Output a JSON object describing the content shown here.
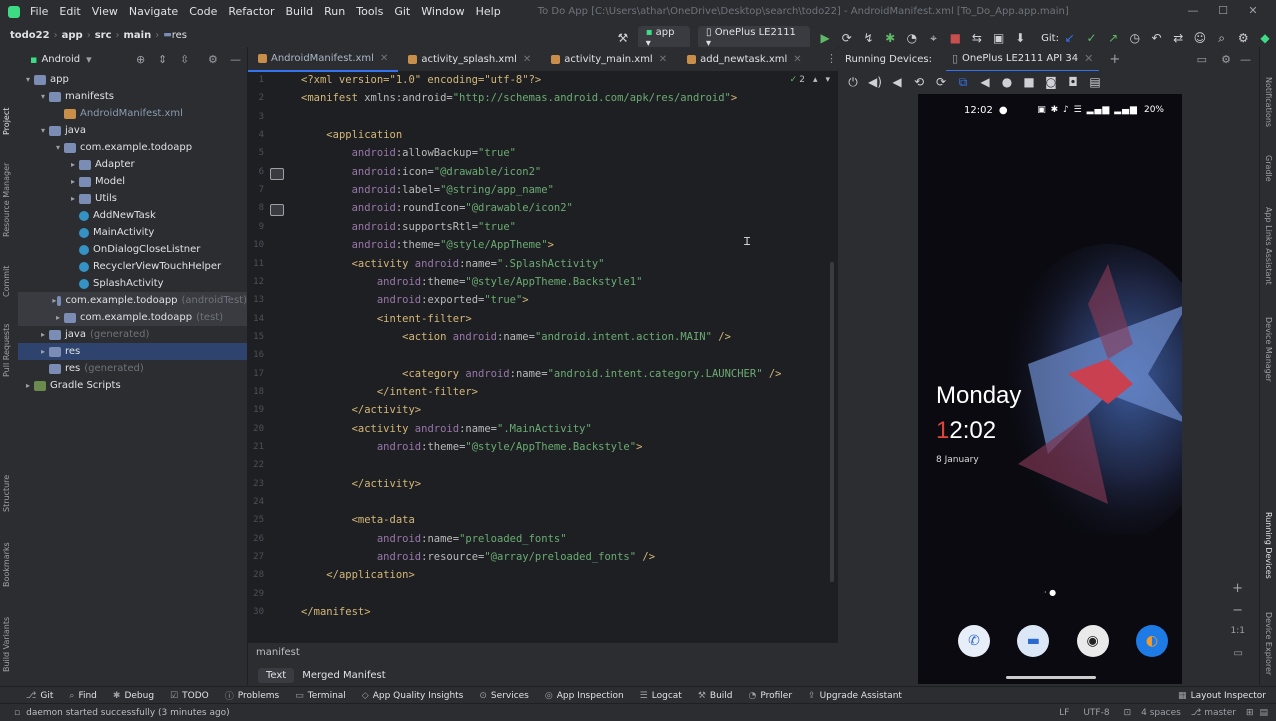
{
  "menu": [
    "File",
    "Edit",
    "View",
    "Navigate",
    "Code",
    "Refactor",
    "Build",
    "Run",
    "Tools",
    "Git",
    "Window",
    "Help"
  ],
  "window_title": "To Do App [C:\\Users\\athar\\OneDrive\\Desktop\\search\\todo22] - AndroidManifest.xml [To_Do_App.app.main]",
  "breadcrumb": [
    "todo22",
    "app",
    "src",
    "main",
    "res"
  ],
  "toolbar": {
    "run_config": "app",
    "device": "OnePlus LE2111",
    "git_label": "Git:"
  },
  "project": {
    "view_label": "Android",
    "tree": [
      {
        "label": "app",
        "indent": 0,
        "arrow": "▾",
        "icon": "folder"
      },
      {
        "label": "manifests",
        "indent": 1,
        "arrow": "▾",
        "icon": "folder"
      },
      {
        "label": "AndroidManifest.xml",
        "indent": 2,
        "arrow": "",
        "icon": "xmlf",
        "muted": true
      },
      {
        "label": "java",
        "indent": 1,
        "arrow": "▾",
        "icon": "folder"
      },
      {
        "label": "com.example.todoapp",
        "indent": 2,
        "arrow": "▾",
        "icon": "folder"
      },
      {
        "label": "Adapter",
        "indent": 3,
        "arrow": "▸",
        "icon": "folder"
      },
      {
        "label": "Model",
        "indent": 3,
        "arrow": "▸",
        "icon": "folder"
      },
      {
        "label": "Utils",
        "indent": 3,
        "arrow": "▸",
        "icon": "folder"
      },
      {
        "label": "AddNewTask",
        "indent": 3,
        "arrow": "",
        "icon": "cls"
      },
      {
        "label": "MainActivity",
        "indent": 3,
        "arrow": "",
        "icon": "cls"
      },
      {
        "label": "OnDialogCloseListner",
        "indent": 3,
        "arrow": "",
        "icon": "cls"
      },
      {
        "label": "RecyclerViewTouchHelper",
        "indent": 3,
        "arrow": "",
        "icon": "cls"
      },
      {
        "label": "SplashActivity",
        "indent": 3,
        "arrow": "",
        "icon": "cls"
      },
      {
        "label": "com.example.todoapp",
        "indent": 2,
        "arrow": "▸",
        "icon": "folder",
        "suffix": "(androidTest)",
        "grey": true
      },
      {
        "label": "com.example.todoapp",
        "indent": 2,
        "arrow": "▸",
        "icon": "folder",
        "suffix": "(test)",
        "grey": true
      },
      {
        "label": "java",
        "indent": 1,
        "arrow": "▸",
        "icon": "folder",
        "suffix": "(generated)"
      },
      {
        "label": "res",
        "indent": 1,
        "arrow": "▸",
        "icon": "folder",
        "selected": true
      },
      {
        "label": "res",
        "indent": 1,
        "arrow": "",
        "icon": "folder",
        "suffix": "(generated)"
      },
      {
        "label": "Gradle Scripts",
        "indent": 0,
        "arrow": "▸",
        "icon": "gradle"
      }
    ]
  },
  "editor_tabs": [
    "AndroidManifest.xml",
    "activity_splash.xml",
    "activity_main.xml",
    "add_newtask.xml"
  ],
  "editor": {
    "problems_count": "2",
    "breadcrumb": "manifest",
    "bottom_tabs": [
      "Text",
      "Merged Manifest"
    ],
    "lines": [
      {
        "n": "1",
        "t": [
          [
            "decl",
            "<?xml version=\"1.0\" encoding=\"utf-8\"?>"
          ]
        ]
      },
      {
        "n": "2",
        "t": [
          [
            "tag",
            "<manifest "
          ],
          [
            "attr",
            "xmlns:android"
          ],
          [
            "pun",
            "="
          ],
          [
            "val",
            "\"http://schemas.android.com/apk/res/android\""
          ],
          [
            "tag",
            ">"
          ]
        ]
      },
      {
        "n": "3",
        "t": []
      },
      {
        "n": "4",
        "t": [
          [
            "pun",
            "    "
          ],
          [
            "tag",
            "<application"
          ]
        ]
      },
      {
        "n": "5",
        "t": [
          [
            "pun",
            "        "
          ],
          [
            "ns",
            "android"
          ],
          [
            "attr",
            ":allowBackup"
          ],
          [
            "pun",
            "="
          ],
          [
            "val",
            "\"true\""
          ]
        ]
      },
      {
        "n": "6",
        "t": [
          [
            "pun",
            "        "
          ],
          [
            "ns",
            "android"
          ],
          [
            "attr",
            ":icon"
          ],
          [
            "pun",
            "="
          ],
          [
            "val",
            "\"@drawable/icon2\""
          ]
        ]
      },
      {
        "n": "7",
        "t": [
          [
            "pun",
            "        "
          ],
          [
            "ns",
            "android"
          ],
          [
            "attr",
            ":label"
          ],
          [
            "pun",
            "="
          ],
          [
            "val",
            "\"@string/app_name\""
          ]
        ]
      },
      {
        "n": "8",
        "t": [
          [
            "pun",
            "        "
          ],
          [
            "ns",
            "android"
          ],
          [
            "attr",
            ":roundIcon"
          ],
          [
            "pun",
            "="
          ],
          [
            "val",
            "\"@drawable/icon2\""
          ]
        ]
      },
      {
        "n": "9",
        "t": [
          [
            "pun",
            "        "
          ],
          [
            "ns",
            "android"
          ],
          [
            "attr",
            ":supportsRtl"
          ],
          [
            "pun",
            "="
          ],
          [
            "val",
            "\"true\""
          ]
        ]
      },
      {
        "n": "10",
        "t": [
          [
            "pun",
            "        "
          ],
          [
            "ns",
            "android"
          ],
          [
            "attr",
            ":theme"
          ],
          [
            "pun",
            "="
          ],
          [
            "val",
            "\"@style/AppTheme\""
          ],
          [
            "tag",
            ">"
          ]
        ]
      },
      {
        "n": "11",
        "t": [
          [
            "pun",
            "        "
          ],
          [
            "tag",
            "<activity "
          ],
          [
            "ns",
            "android"
          ],
          [
            "attr",
            ":name"
          ],
          [
            "pun",
            "="
          ],
          [
            "val",
            "\".SplashActivity\""
          ]
        ]
      },
      {
        "n": "12",
        "t": [
          [
            "pun",
            "            "
          ],
          [
            "ns",
            "android"
          ],
          [
            "attr",
            ":theme"
          ],
          [
            "pun",
            "="
          ],
          [
            "val",
            "\"@style/AppTheme.Backstyle1\""
          ]
        ]
      },
      {
        "n": "13",
        "t": [
          [
            "pun",
            "            "
          ],
          [
            "ns",
            "android"
          ],
          [
            "attr",
            ":exported"
          ],
          [
            "pun",
            "="
          ],
          [
            "val",
            "\"true\""
          ],
          [
            "tag",
            ">"
          ]
        ]
      },
      {
        "n": "14",
        "t": [
          [
            "pun",
            "            "
          ],
          [
            "tag",
            "<intent-filter>"
          ]
        ]
      },
      {
        "n": "15",
        "t": [
          [
            "pun",
            "                "
          ],
          [
            "tag",
            "<action "
          ],
          [
            "ns",
            "android"
          ],
          [
            "attr",
            ":name"
          ],
          [
            "pun",
            "="
          ],
          [
            "val",
            "\"android.intent.action.MAIN\""
          ],
          [
            "tag",
            " />"
          ]
        ]
      },
      {
        "n": "16",
        "t": []
      },
      {
        "n": "17",
        "t": [
          [
            "pun",
            "                "
          ],
          [
            "tag",
            "<category "
          ],
          [
            "ns",
            "android"
          ],
          [
            "attr",
            ":name"
          ],
          [
            "pun",
            "="
          ],
          [
            "val",
            "\"android.intent.category.LAUNCHER\""
          ],
          [
            "tag",
            " />"
          ]
        ]
      },
      {
        "n": "18",
        "t": [
          [
            "pun",
            "            "
          ],
          [
            "tag",
            "</intent-filter>"
          ]
        ]
      },
      {
        "n": "19",
        "t": [
          [
            "pun",
            "        "
          ],
          [
            "tag",
            "</activity>"
          ]
        ]
      },
      {
        "n": "20",
        "t": [
          [
            "pun",
            "        "
          ],
          [
            "tag",
            "<activity "
          ],
          [
            "ns",
            "android"
          ],
          [
            "attr",
            ":name"
          ],
          [
            "pun",
            "="
          ],
          [
            "val",
            "\".MainActivity\""
          ]
        ]
      },
      {
        "n": "21",
        "t": [
          [
            "pun",
            "            "
          ],
          [
            "ns",
            "android"
          ],
          [
            "attr",
            ":theme"
          ],
          [
            "pun",
            "="
          ],
          [
            "val",
            "\"@style/AppTheme.Backstyle\""
          ],
          [
            "tag",
            ">"
          ]
        ]
      },
      {
        "n": "22",
        "t": []
      },
      {
        "n": "23",
        "t": [
          [
            "pun",
            "        "
          ],
          [
            "tag",
            "</activity>"
          ]
        ]
      },
      {
        "n": "24",
        "t": []
      },
      {
        "n": "25",
        "t": [
          [
            "pun",
            "        "
          ],
          [
            "tag",
            "<meta-data"
          ]
        ]
      },
      {
        "n": "26",
        "t": [
          [
            "pun",
            "            "
          ],
          [
            "ns",
            "android"
          ],
          [
            "attr",
            ":name"
          ],
          [
            "pun",
            "="
          ],
          [
            "val",
            "\"preloaded_fonts\""
          ]
        ]
      },
      {
        "n": "27",
        "t": [
          [
            "pun",
            "            "
          ],
          [
            "ns",
            "android"
          ],
          [
            "attr",
            ":resource"
          ],
          [
            "pun",
            "="
          ],
          [
            "val",
            "\"@array/preloaded_fonts\""
          ],
          [
            "tag",
            " />"
          ]
        ]
      },
      {
        "n": "28",
        "t": [
          [
            "pun",
            "    "
          ],
          [
            "tag",
            "</application>"
          ]
        ]
      },
      {
        "n": "29",
        "t": []
      },
      {
        "n": "30",
        "t": [
          [
            "tag",
            "</manifest>"
          ]
        ]
      }
    ]
  },
  "running_devices": {
    "label": "Running Devices:",
    "device_tab": "OnePlus LE2111 API 34",
    "phone": {
      "status_time": "12:02",
      "battery": "20%",
      "day": "Monday",
      "clock_first": "1",
      "clock_rest": "2:02",
      "date": "8 January"
    }
  },
  "left_stripe": [
    "Project",
    "Resource Manager",
    "Commit",
    "Pull Requests",
    "Structure",
    "Bookmarks",
    "Build Variants"
  ],
  "right_stripe": [
    "Notifications",
    "Gradle",
    "App Links Assistant",
    "Device Manager",
    "Running Devices",
    "Device Explorer"
  ],
  "bottom_tools": [
    "Git",
    "Find",
    "Debug",
    "TODO",
    "Problems",
    "Terminal",
    "App Quality Insights",
    "Services",
    "App Inspection",
    "Logcat",
    "Build",
    "Profiler",
    "Upgrade Assistant"
  ],
  "layout_inspector": "Layout Inspector",
  "status": {
    "message": "daemon started successfully (3 minutes ago)",
    "line_sep": "LF",
    "encoding": "UTF-8",
    "indent": "4 spaces",
    "branch": "master"
  },
  "colors": {
    "accent": "#3574f0",
    "selection": "#2e436e",
    "run_green": "#5fb865"
  }
}
